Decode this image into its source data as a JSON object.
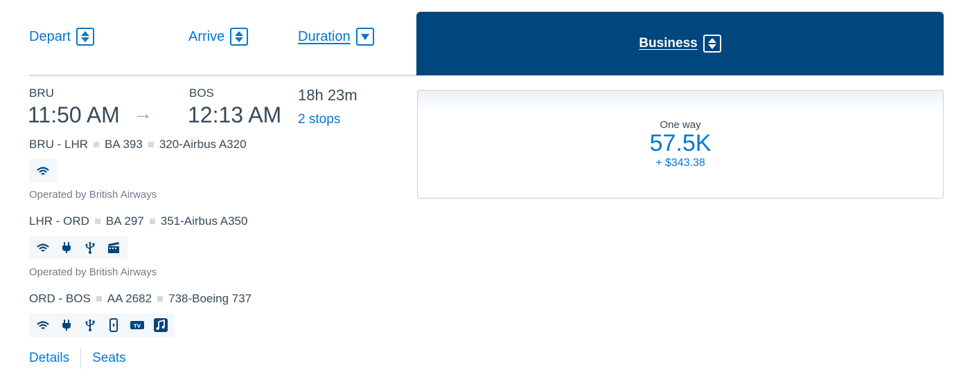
{
  "header": {
    "depart_label": "Depart",
    "arrive_label": "Arrive",
    "duration_label": "Duration",
    "business_label": "Business"
  },
  "flight": {
    "origin_code": "BRU",
    "depart_time": "11:50 AM",
    "destination_code": "BOS",
    "arrive_time": "12:13 AM",
    "duration": "18h 23m",
    "stops": "2 stops",
    "segments": [
      {
        "route": "BRU - LHR",
        "flight_number": "BA 393",
        "aircraft": "320-Airbus A320",
        "amenities": [
          "wifi-icon"
        ],
        "operated_by": "Operated by British Airways"
      },
      {
        "route": "LHR - ORD",
        "flight_number": "BA 297",
        "aircraft": "351-Airbus A350",
        "amenities": [
          "wifi-icon",
          "power-plug-icon",
          "usb-icon",
          "video-icon"
        ],
        "operated_by": "Operated by British Airways"
      },
      {
        "route": "ORD - BOS",
        "flight_number": "AA 2682",
        "aircraft": "738-Boeing 737",
        "amenities": [
          "wifi-icon",
          "power-plug-icon",
          "usb-icon",
          "device-entertainment-icon",
          "tv-icon",
          "music-icon"
        ]
      }
    ],
    "links": {
      "details": "Details",
      "seats": "Seats"
    }
  },
  "price": {
    "label": "One way",
    "miles": "57.5K",
    "fee": "+ $343.38"
  },
  "colors": {
    "accent": "#0078d2",
    "header_bg": "#00467f",
    "text": "#36495a"
  }
}
